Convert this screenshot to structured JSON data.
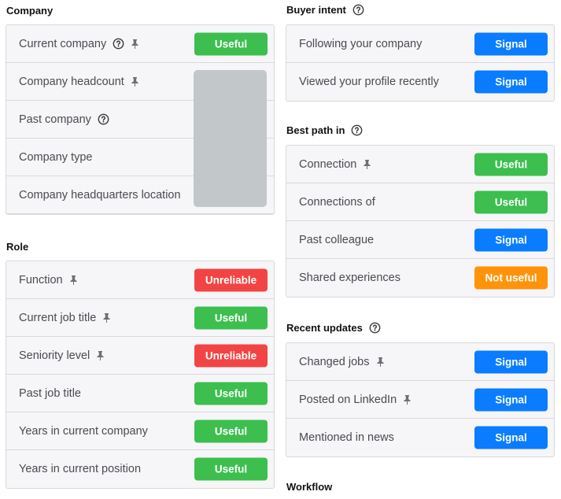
{
  "company": {
    "title": "Company",
    "rows": [
      {
        "label": "Current company",
        "badge": "Useful"
      },
      {
        "label": "Company headcount"
      },
      {
        "label": "Past company"
      },
      {
        "label": "Company type"
      },
      {
        "label": "Company headquarters location"
      }
    ]
  },
  "role": {
    "title": "Role",
    "rows": [
      {
        "label": "Function",
        "badge": "Unreliable"
      },
      {
        "label": "Current job title",
        "badge": "Useful"
      },
      {
        "label": "Seniority level",
        "badge": "Unreliable"
      },
      {
        "label": "Past job title",
        "badge": "Useful"
      },
      {
        "label": "Years in current company",
        "badge": "Useful"
      },
      {
        "label": "Years in current position",
        "badge": "Useful"
      }
    ]
  },
  "buyer_intent": {
    "title": "Buyer intent",
    "rows": [
      {
        "label": "Following your company",
        "badge": "Signal"
      },
      {
        "label": "Viewed your profile recently",
        "badge": "Signal"
      }
    ]
  },
  "best_path": {
    "title": "Best path in",
    "rows": [
      {
        "label": "Connection",
        "badge": "Useful"
      },
      {
        "label": "Connections of",
        "badge": "Useful"
      },
      {
        "label": "Past colleague",
        "badge": "Signal"
      },
      {
        "label": "Shared experiences",
        "badge": "Not useful"
      }
    ]
  },
  "recent_updates": {
    "title": "Recent updates",
    "rows": [
      {
        "label": "Changed jobs",
        "badge": "Signal"
      },
      {
        "label": "Posted on LinkedIn",
        "badge": "Signal"
      },
      {
        "label": "Mentioned in news",
        "badge": "Signal"
      }
    ]
  },
  "workflow": {
    "title": "Workflow"
  },
  "colors": {
    "useful": "#3cbf4e",
    "signal": "#0a7cff",
    "unreliable": "#f24444",
    "not_useful": "#ff930a"
  }
}
